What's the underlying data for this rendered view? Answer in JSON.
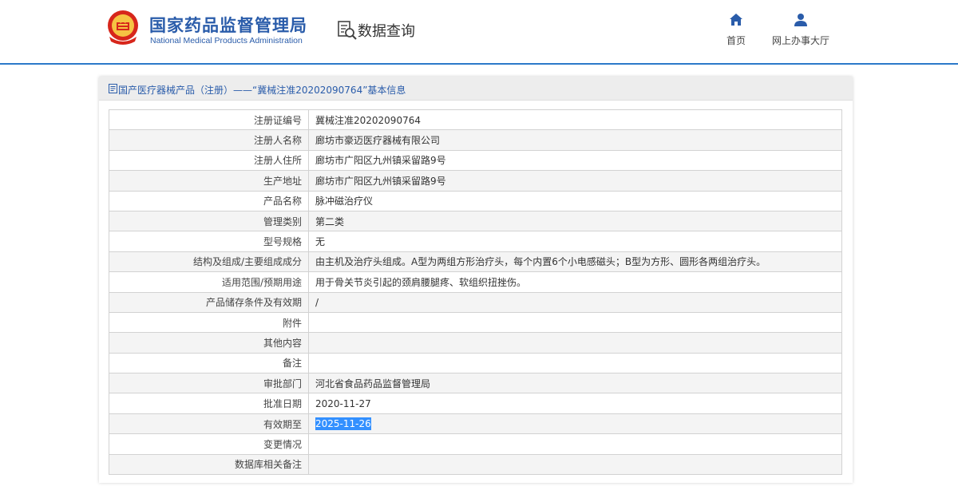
{
  "header": {
    "org_name_cn": "国家药品监督管理局",
    "org_name_en": "National Medical Products Administration",
    "section_title": "数据查询",
    "nav": [
      {
        "label": "首页",
        "icon": "home-icon"
      },
      {
        "label": "网上办事大厅",
        "icon": "user-icon"
      }
    ]
  },
  "breadcrumb": {
    "text": "国产医疗器械产品（注册）——“冀械注准20202090764”基本信息"
  },
  "detail": {
    "rows": [
      {
        "key": "注册证编号",
        "value": "冀械注准20202090764"
      },
      {
        "key": "注册人名称",
        "value": "廊坊市豪迈医疗器械有限公司"
      },
      {
        "key": "注册人住所",
        "value": "廊坊市广阳区九州镇采留路9号"
      },
      {
        "key": "生产地址",
        "value": "廊坊市广阳区九州镇采留路9号"
      },
      {
        "key": "产品名称",
        "value": "脉冲磁治疗仪"
      },
      {
        "key": "管理类别",
        "value": "第二类"
      },
      {
        "key": "型号规格",
        "value": "无"
      },
      {
        "key": "结构及组成/主要组成成分",
        "value": "由主机及治疗头组成。A型为两组方形治疗头，每个内置6个小电感磁头；B型为方形、圆形各两组治疗头。"
      },
      {
        "key": "适用范围/预期用途",
        "value": "用于骨关节炎引起的颈肩腰腿疼、软组织扭挫伤。"
      },
      {
        "key": "产品储存条件及有效期",
        "value": "/"
      },
      {
        "key": "附件",
        "value": ""
      },
      {
        "key": "其他内容",
        "value": ""
      },
      {
        "key": "备注",
        "value": ""
      },
      {
        "key": "审批部门",
        "value": "河北省食品药品监督管理局"
      },
      {
        "key": "批准日期",
        "value": "2020-11-27"
      },
      {
        "key": "有效期至",
        "value": "2025-11-26"
      },
      {
        "key": "变更情况",
        "value": ""
      },
      {
        "key": "数据库相关备注",
        "value": ""
      }
    ]
  },
  "colors": {
    "brand_blue": "#2a5caa",
    "header_rule": "#2c79c9",
    "selection": "#3390ff"
  }
}
